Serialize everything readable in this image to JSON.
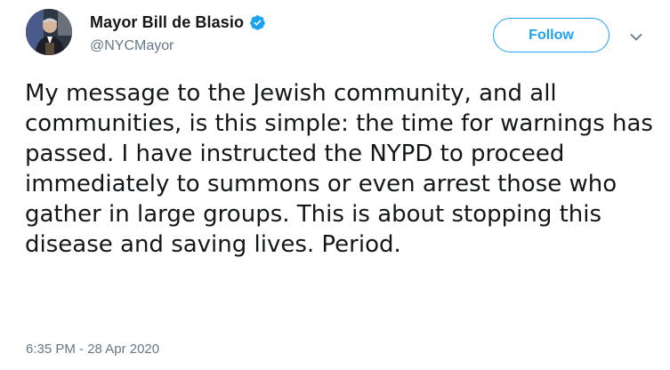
{
  "author": {
    "name": "Mayor Bill de Blasio",
    "handle": "@NYCMayor",
    "verified": true
  },
  "follow_label": "Follow",
  "tweet": {
    "text": "My message to the Jewish community, and all communities, is this simple: the time for warnings has passed. I have instructed the NYPD to proceed immediately to summons or even arrest those who gather in large groups. This is about stopping this disease and saving lives. Period.",
    "timestamp": "6:35 PM - 28 Apr 2020"
  },
  "colors": {
    "accent": "#1da1f2",
    "text": "#14171a",
    "secondary": "#657786"
  },
  "icons": {
    "avatar": "avatar-photo",
    "verified": "verified-badge-icon",
    "menu": "chevron-down-icon"
  }
}
